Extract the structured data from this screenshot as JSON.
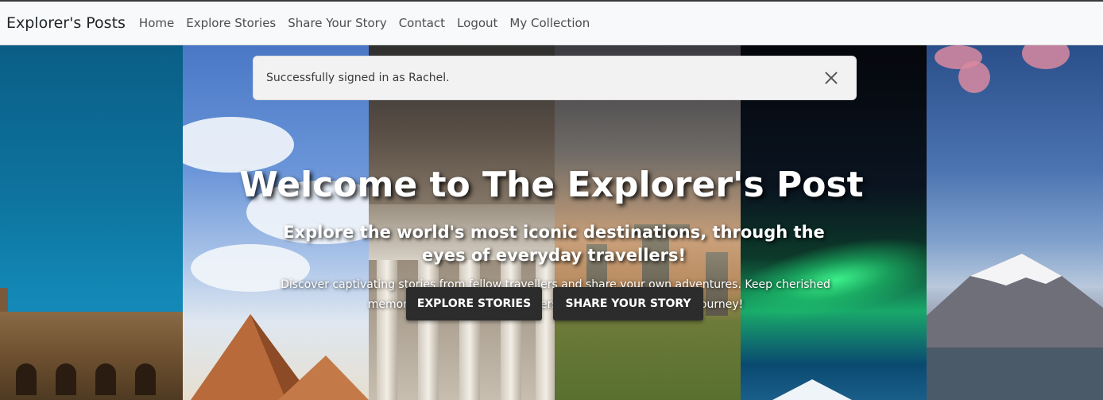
{
  "navbar": {
    "brand": "Explorer's Posts",
    "links": [
      "Home",
      "Explore Stories",
      "Share Your Story",
      "Contact",
      "Logout",
      "My Collection"
    ]
  },
  "alert": {
    "message": "Successfully signed in as Rachel."
  },
  "hero": {
    "title": "Welcome to The Explorer's Post",
    "subtitle": "Explore the world's most iconic destinations, through the eyes of everyday travellers!",
    "description": "Discover captivating stories from fellow travellers and share your own adventures. Keep cherished memories alive and inspire others to embark on their next journey!",
    "buttons": {
      "explore": "EXPLORE STORIES",
      "share": "SHARE YOUR STORY"
    }
  }
}
